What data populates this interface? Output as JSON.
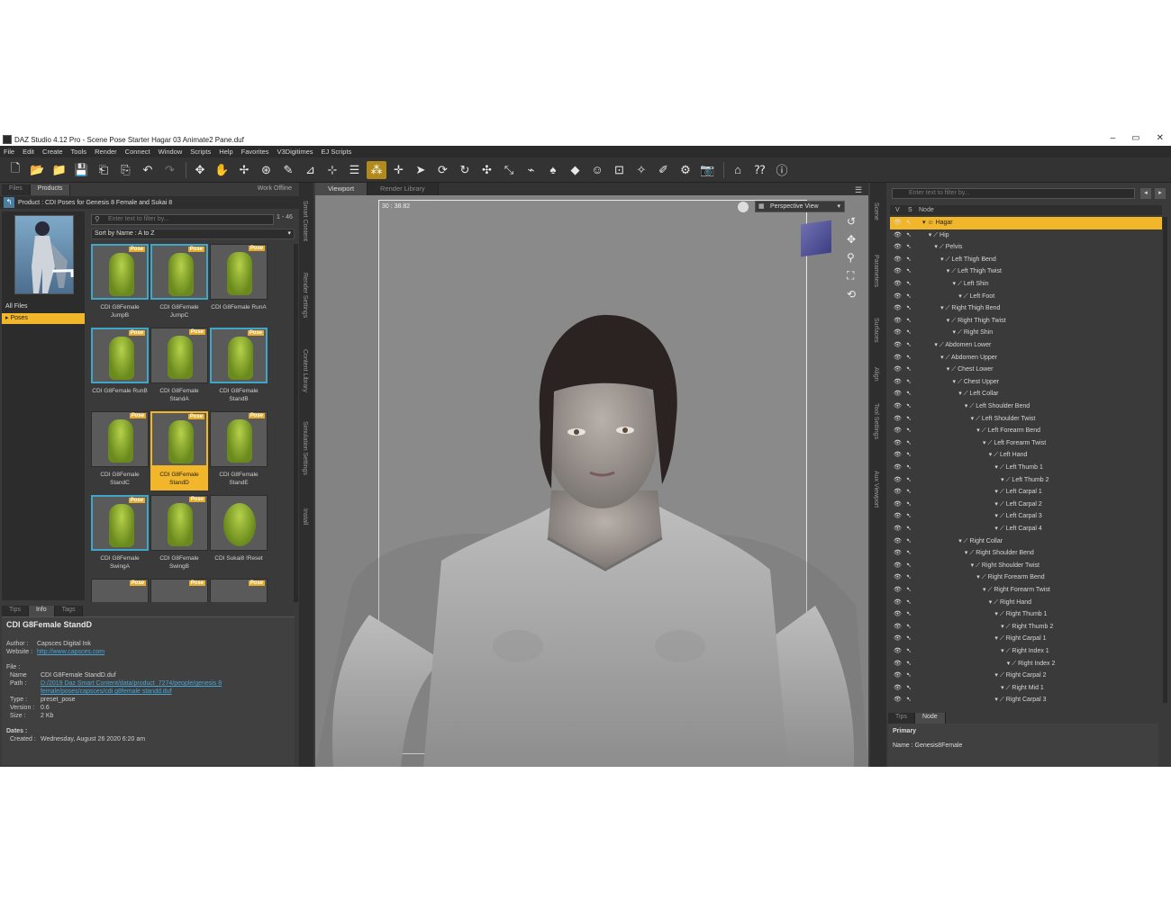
{
  "window": {
    "title": "DAZ Studio 4.12 Pro - Scene Pose Starter Hagar 03 Animate2 Pane.duf",
    "min": "–",
    "max": "▭",
    "close": "✕"
  },
  "menu": [
    "File",
    "Edit",
    "Create",
    "Tools",
    "Render",
    "Connect",
    "Window",
    "Scripts",
    "Help",
    "Favorites",
    "V3Digitimes",
    "EJ Scripts"
  ],
  "left": {
    "tabs": [
      "Files",
      "Products"
    ],
    "work_offline": "Work Offline",
    "product_label": "Product : CDI Poses for Genesis 8 Female and Sukai 8",
    "filter_placeholder": "Enter text to filter by...",
    "count": "1 - 46",
    "sort": "Sort by Name : A to Z",
    "categories": [
      "All Files",
      "Poses"
    ],
    "badge": "Pose",
    "tiles": [
      "CDI G8Female JumpB",
      "CDI G8Female JumpC",
      "CDI G8Female RunA",
      "CDI G8Female RunB",
      "CDI G8Female StandA",
      "CDI G8Female StandB",
      "CDI G8Female StandC",
      "CDI G8Female StandD",
      "CDI G8Female StandE",
      "CDI G8Female SwingA",
      "CDI G8Female SwingB",
      "CDI Sukai8 !Reset"
    ],
    "info_tabs": [
      "Tips",
      "Info",
      "Tags"
    ],
    "info": {
      "title": "CDI G8Female StandD",
      "author_k": "Author :",
      "author_v": "Capsces Digital Ink",
      "website_k": "Website :",
      "website_v": "http://www.capsces.com",
      "file_h": "File :",
      "name_k": "Name",
      "name_v": "CDI G8Female StandD.duf",
      "path_k": "Path :",
      "path_v": "D:/2019 Daz Smart Content/data/product_7274/people/genesis 8 female/poses/capsces/cdi g8female standd.duf",
      "type_k": "Type :",
      "type_v": "preset_pose",
      "version_k": "Version :",
      "version_v": "0.6",
      "size_k": "Size :",
      "size_v": "2 Kb",
      "dates_h": "Dates :",
      "created_k": "Created :",
      "created_v": "Wednesday, August 26 2020 6:20 am"
    }
  },
  "side_tabs": [
    "Smart Content",
    "Render Settings",
    "Content Library",
    "Simulation Settings",
    "Install"
  ],
  "viewport": {
    "tabs": [
      "Viewport",
      "Render Library"
    ],
    "fps": "30 : 38.82",
    "view": "Perspective View"
  },
  "right_side_tabs": [
    "Scene",
    "Parameters",
    "Surfaces",
    "Align",
    "Tool Settings",
    "Aux Viewport"
  ],
  "scene": {
    "search_placeholder": "Enter text to filter by...",
    "head_v": "V",
    "head_s": "S",
    "head_node": "Node",
    "nodes": [
      {
        "label": "Hagar",
        "depth": 0
      },
      {
        "label": "Hip",
        "depth": 1
      },
      {
        "label": "Pelvis",
        "depth": 2
      },
      {
        "label": "Left Thigh Bend",
        "depth": 3
      },
      {
        "label": "Left Thigh Twist",
        "depth": 4
      },
      {
        "label": "Left Shin",
        "depth": 5
      },
      {
        "label": "Left Foot",
        "depth": 6
      },
      {
        "label": "Right Thigh Bend",
        "depth": 3
      },
      {
        "label": "Right Thigh Twist",
        "depth": 4
      },
      {
        "label": "Right Shin",
        "depth": 5
      },
      {
        "label": "Abdomen Lower",
        "depth": 2
      },
      {
        "label": "Abdomen Upper",
        "depth": 3
      },
      {
        "label": "Chest Lower",
        "depth": 4
      },
      {
        "label": "Chest Upper",
        "depth": 5
      },
      {
        "label": "Left Collar",
        "depth": 6
      },
      {
        "label": "Left Shoulder Bend",
        "depth": 7
      },
      {
        "label": "Left Shoulder Twist",
        "depth": 8
      },
      {
        "label": "Left Forearm Bend",
        "depth": 9
      },
      {
        "label": "Left Forearm Twist",
        "depth": 10
      },
      {
        "label": "Left Hand",
        "depth": 11
      },
      {
        "label": "Left Thumb 1",
        "depth": 12
      },
      {
        "label": "Left Thumb 2",
        "depth": 13
      },
      {
        "label": "Left Carpal 1",
        "depth": 12
      },
      {
        "label": "Left Carpal 2",
        "depth": 12
      },
      {
        "label": "Left Carpal 3",
        "depth": 12
      },
      {
        "label": "Left Carpal 4",
        "depth": 12
      },
      {
        "label": "Right Collar",
        "depth": 6
      },
      {
        "label": "Right Shoulder Bend",
        "depth": 7
      },
      {
        "label": "Right Shoulder Twist",
        "depth": 8
      },
      {
        "label": "Right Forearm Bend",
        "depth": 9
      },
      {
        "label": "Right Forearm Twist",
        "depth": 10
      },
      {
        "label": "Right Hand",
        "depth": 11
      },
      {
        "label": "Right Thumb 1",
        "depth": 12
      },
      {
        "label": "Right Thumb 2",
        "depth": 13
      },
      {
        "label": "Right Carpal 1",
        "depth": 12
      },
      {
        "label": "Right Index 1",
        "depth": 13
      },
      {
        "label": "Right Index 2",
        "depth": 14
      },
      {
        "label": "Right Carpal 2",
        "depth": 12
      },
      {
        "label": "Right Mid 1",
        "depth": 13
      },
      {
        "label": "Right Carpal 3",
        "depth": 12
      }
    ],
    "bottom_tabs": [
      "Tips",
      "Node"
    ],
    "primary": "Primary",
    "name_line": "Name : Genesis8Female"
  },
  "colors": {
    "accent": "#f1b629",
    "select_border": "#3fa6c8"
  }
}
